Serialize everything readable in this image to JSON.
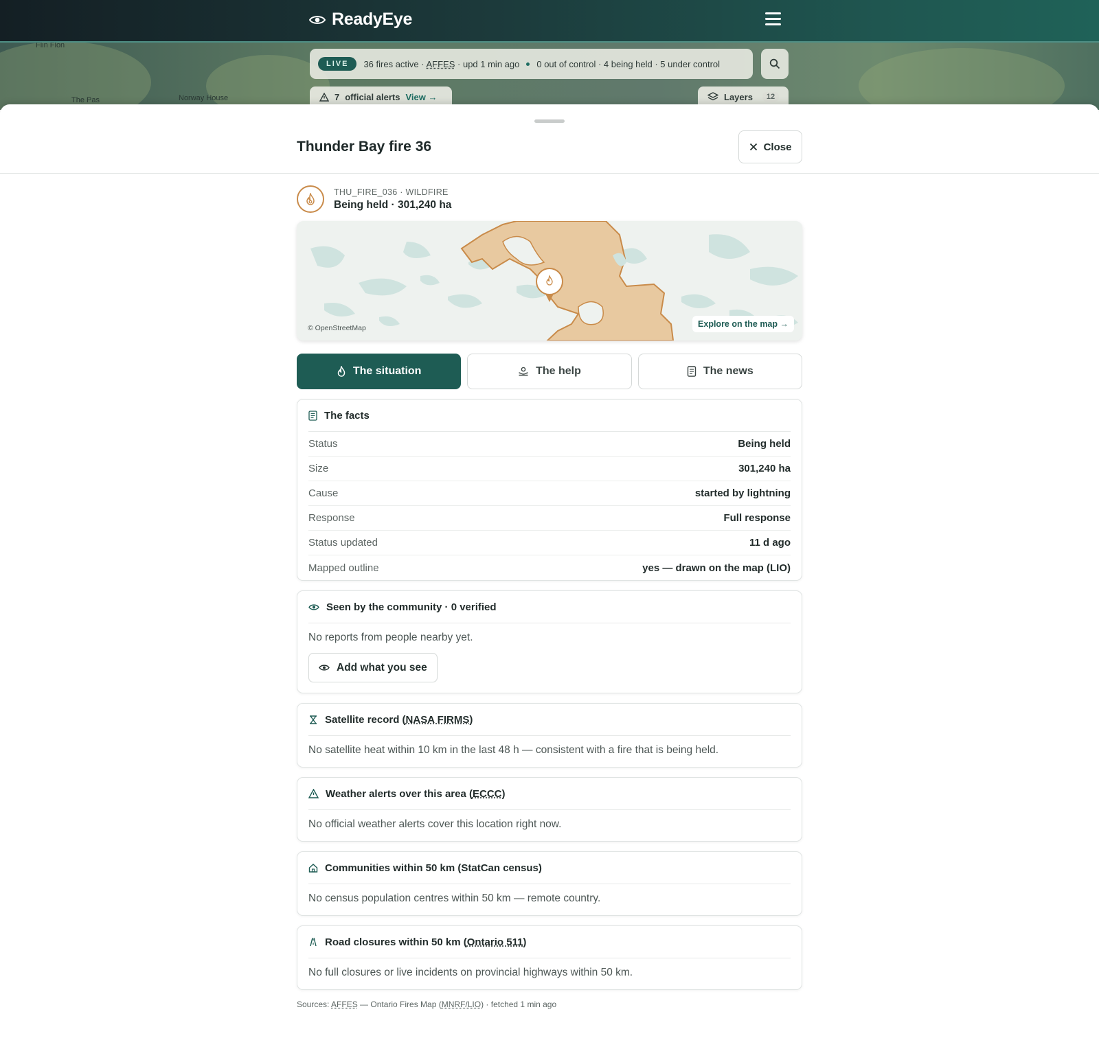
{
  "header": {
    "brand_name": "ReadyEye",
    "menu_icon": "hamburger-icon"
  },
  "background_map": {
    "places": [
      "Flin Flon",
      "The Pas",
      "Norway House"
    ]
  },
  "status_bar": {
    "live_label": "LIVE",
    "active_text": "36 fires active · ",
    "agency": "AFFES",
    "updated_text": " · upd 1 min ago",
    "control_text": "0 out of control · 4 being held · 5 under control"
  },
  "alerts": {
    "count": "7",
    "label": "official alerts",
    "view_label": "View →"
  },
  "layers": {
    "label": "Layers",
    "count": "12"
  },
  "sheet": {
    "title": "Thunder Bay fire 36",
    "close_label": "Close"
  },
  "fire": {
    "id_line": "THU_FIRE_036 · WILDFIRE",
    "summary": "Being held · 301,240 ha"
  },
  "minimap": {
    "attribution": "© OpenStreetMap",
    "explore_label": "Explore on the map →"
  },
  "tabs": [
    {
      "label": "The situation",
      "icon": "flame-icon",
      "active": true
    },
    {
      "label": "The help",
      "icon": "helping-hand-icon",
      "active": false
    },
    {
      "label": "The news",
      "icon": "document-icon",
      "active": false
    }
  ],
  "facts": {
    "title": "The facts",
    "rows": [
      {
        "k": "Status",
        "v": "Being held"
      },
      {
        "k": "Size",
        "v": "301,240 ha"
      },
      {
        "k": "Cause",
        "v": "started by lightning"
      },
      {
        "k": "Response",
        "v": "Full response"
      },
      {
        "k": "Status updated",
        "v": "11 d ago"
      },
      {
        "k": "Mapped outline",
        "v": "yes — drawn on the map (LIO)"
      }
    ]
  },
  "community": {
    "title": "Seen by the community · 0 verified",
    "body": "No reports from people nearby yet.",
    "button_label": "Add what you see"
  },
  "satellite": {
    "title_pre": "Satellite record (",
    "title_link": "NASA FIRMS",
    "title_post": ")",
    "body": "No satellite heat within 10 km in the last 48 h — consistent with a fire that is being held."
  },
  "weather": {
    "title_pre": "Weather alerts over this area (",
    "title_link": "ECCC",
    "title_post": ")",
    "body": "No official weather alerts cover this location right now."
  },
  "communities": {
    "title": "Communities within 50 km (StatCan census)",
    "body": "No census population centres within 50 km — remote country."
  },
  "roads": {
    "title_pre": "Road closures within 50 km (",
    "title_link": "Ontario 511",
    "title_post": ")",
    "body": "No full closures or live incidents on provincial highways within 50 km."
  },
  "sources": {
    "prefix": "Sources: ",
    "agency": "AFFES",
    "mid": " — Ontario Fires Map (",
    "link": "MNRF/LIO",
    "suffix": ") · fetched 1 min ago"
  },
  "colors": {
    "brand_teal": "#1e5c54",
    "fire_orange": "#c98b4a",
    "fire_fill": "#e8c9a0"
  }
}
